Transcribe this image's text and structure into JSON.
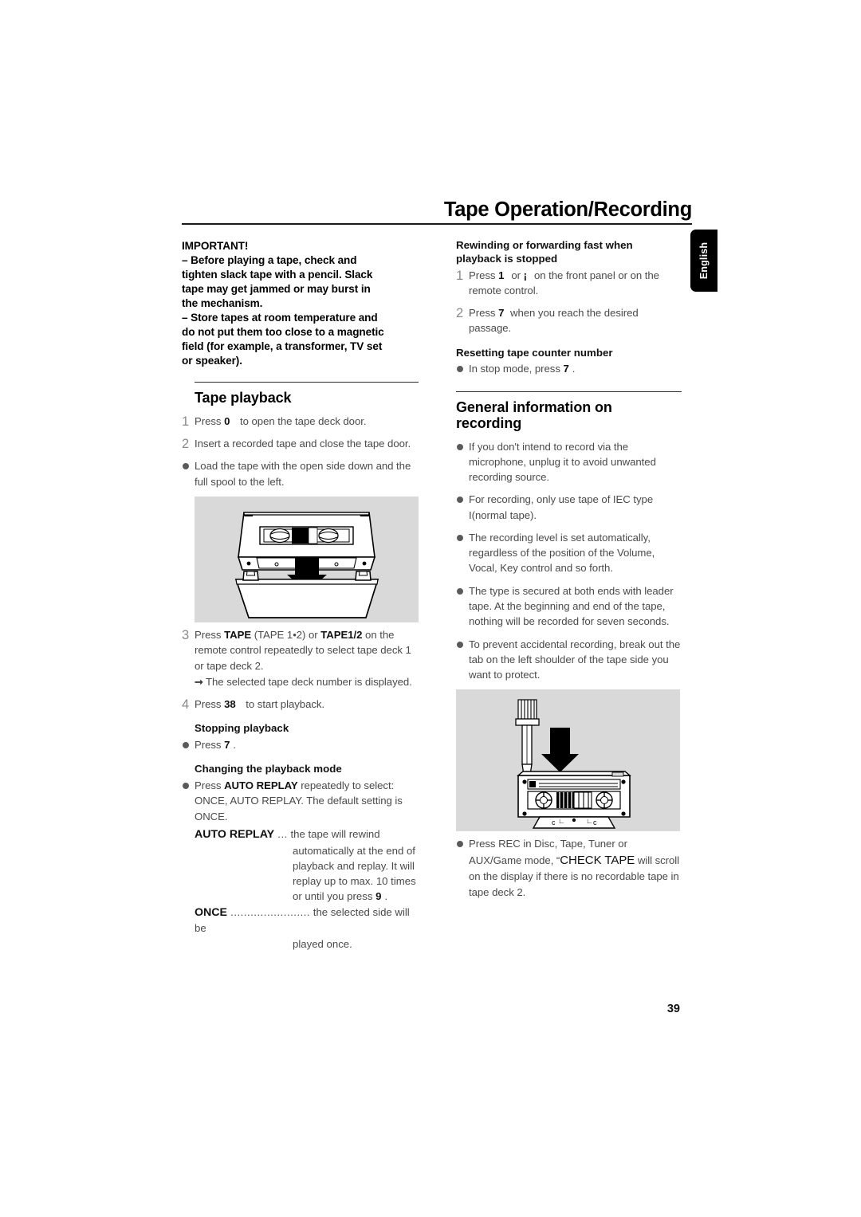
{
  "header": {
    "title": "Tape Operation/Recording",
    "language_tab": "English"
  },
  "page_number": "39",
  "left_column": {
    "important": {
      "heading": "IMPORTANT!",
      "lines": [
        "– Before playing a tape, check and",
        "tighten slack tape with a pencil. Slack",
        "tape may get jammed or may burst in",
        "the mechanism.",
        "– Store tapes at room temperature and",
        "do not put them too close to a magnetic",
        "field (for example, a transformer, TV set",
        "or speaker)."
      ]
    },
    "tape_playback": {
      "title": "Tape playback",
      "steps": [
        {
          "marker": "1",
          "type": "number",
          "pre": "Press ",
          "key": "0",
          "post": " to open the tape deck door."
        },
        {
          "marker": "2",
          "type": "number",
          "text": "Insert a recorded tape and close the tape door."
        },
        {
          "marker": "●",
          "type": "bullet",
          "text": "Load the tape with the open side down and the full spool to the left."
        }
      ],
      "figure_caption": "cassette-loading-illustration",
      "steps_after": [
        {
          "marker": "3",
          "type": "number",
          "segments": [
            {
              "t": "Press ",
              "b": false
            },
            {
              "t": "TAPE",
              "b": true
            },
            {
              "t": " (TAPE 1•2) or ",
              "b": false
            },
            {
              "t": "TAPE1/2",
              "b": true
            },
            {
              "t": " on the remote control repeatedly to select tape deck 1 or tape deck 2.",
              "b": false
            }
          ],
          "arrow_note": "The selected tape deck number is displayed."
        },
        {
          "marker": "4",
          "type": "number",
          "pre": "Press ",
          "key": "38",
          "post": " to start playback."
        }
      ],
      "stopping": {
        "title": "Stopping playback",
        "pre": "Press ",
        "key": "7",
        "post": "."
      },
      "changing_mode": {
        "title": "Changing the playback mode",
        "intro_segments": [
          {
            "t": "Press ",
            "b": false
          },
          {
            "t": "AUTO REPLAY",
            "b": true
          },
          {
            "t": " repeatedly to select: ONCE, AUTO REPLAY. The default setting is ONCE.",
            "b": false
          }
        ],
        "definitions": [
          {
            "term": "AUTO REPLAY",
            "dots": " ...",
            "first_line": "the tape will rewind",
            "rest": "automatically at the end of playback and replay. It will replay up to max. 10 times or until you press ",
            "key": "9",
            "tail": "."
          },
          {
            "term": "ONCE",
            "dots": " ........................",
            "first_line": "the selected side will be",
            "rest": "played once.",
            "key": "",
            "tail": ""
          }
        ]
      }
    }
  },
  "right_column": {
    "rewind_section": {
      "title_line1": "Rewinding or forwarding fast when",
      "title_line2": "playback is stopped",
      "steps": [
        {
          "marker": "1",
          "pre": "Press ",
          "key1": "1",
          "mid": "or ",
          "key2": "¡",
          "post": "on the front panel or on the remote control."
        },
        {
          "marker": "2",
          "pre": "Press ",
          "key1": "7",
          "post": " when you reach the desired passage."
        }
      ]
    },
    "reset_section": {
      "title": "Resetting tape counter number",
      "pre": "In stop mode, press ",
      "key": "7",
      "post": "."
    },
    "general_info": {
      "title_line1": "General information on",
      "title_line2": "recording",
      "bullets": [
        "If  you don't intend to record via the microphone, unplug it to avoid unwanted recording source.",
        "For recording, only use tape of IEC type I(normal tape).",
        "The recording level is set automatically, regardless of the position of the Volume, Vocal, Key control and so forth.",
        "The type is secured at both ends with leader tape. At the beginning and end of the tape, nothing will be recorded for seven seconds.",
        "To prevent accidental recording, break out the tab on the left shoulder of the tape side you want to protect."
      ],
      "figure_caption": "break-out-tab-illustration",
      "final_bullet": {
        "pre": "Press REC in Disc, Tape, Tuner or AUX/Game mode, “",
        "emph": "CHECK TAPE",
        "post": " will scroll on the display if there is no recordable tape in tape deck 2."
      }
    }
  },
  "colors": {
    "figure_background": "#d9d9d9",
    "body_text": "#4a4a4a",
    "heading_text": "#000000",
    "tab_background": "#000000"
  }
}
